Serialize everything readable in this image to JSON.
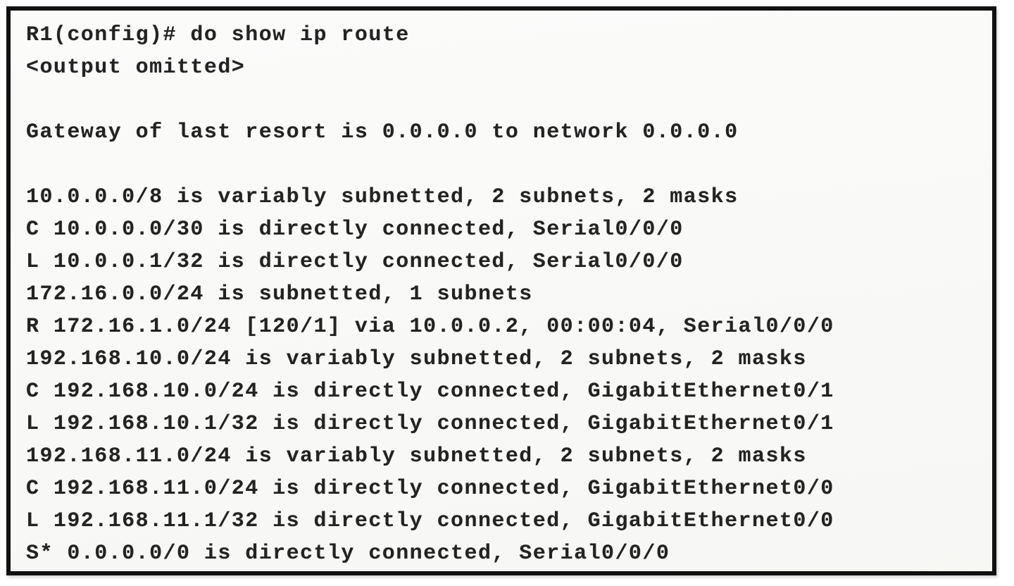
{
  "device": {
    "hostname": "R1",
    "mode": "config",
    "prompt": "R1(config)#"
  },
  "command": {
    "prompt_line": "R1(config)# do show ip route",
    "entered": "do show ip route",
    "omitted_notice": "<output omitted>"
  },
  "routing_table": {
    "gateway_of_last_resort": "Gateway of last resort is 0.0.0.0 to network 0.0.0.0",
    "lines": [
      "R1(config)# do show ip route",
      "<output omitted>",
      "",
      "Gateway of last resort is 0.0.0.0 to network 0.0.0.0",
      "",
      "10.0.0.0/8 is variably subnetted, 2 subnets, 2 masks",
      "C 10.0.0.0/30 is directly connected, Serial0/0/0",
      "L 10.0.0.1/32 is directly connected, Serial0/0/0",
      "172.16.0.0/24 is subnetted, 1 subnets",
      "R 172.16.1.0/24 [120/1] via 10.0.0.2, 00:00:04, Serial0/0/0",
      "192.168.10.0/24 is variably subnetted, 2 subnets, 2 masks",
      "C 192.168.10.0/24 is directly connected, GigabitEthernet0/1",
      "L 192.168.10.1/32 is directly connected, GigabitEthernet0/1",
      "192.168.11.0/24 is variably subnetted, 2 subnets, 2 masks",
      "C 192.168.11.0/24 is directly connected, GigabitEthernet0/0",
      "L 192.168.11.1/32 is directly connected, GigabitEthernet0/0",
      "S* 0.0.0.0/0 is directly connected, Serial0/0/0"
    ],
    "parent_networks": [
      {
        "network": "10.0.0.0/8",
        "subnetting": "is variably subnetted",
        "subnets": "2 subnets",
        "masks": "2 masks"
      },
      {
        "network": "172.16.0.0/24",
        "subnetting": "is subnetted",
        "subnets": "1 subnets",
        "masks": ""
      },
      {
        "network": "192.168.10.0/24",
        "subnetting": "is variably subnetted",
        "subnets": "2 subnets",
        "masks": "2 masks"
      },
      {
        "network": "192.168.11.0/24",
        "subnetting": "is variably subnetted",
        "subnets": "2 subnets",
        "masks": "2 masks"
      }
    ],
    "routes": [
      {
        "code": "C",
        "prefix": "10.0.0.0/30",
        "descriptor": "is directly connected",
        "metric": "",
        "next_hop": "",
        "uptime": "",
        "interface": "Serial0/0/0"
      },
      {
        "code": "L",
        "prefix": "10.0.0.1/32",
        "descriptor": "is directly connected",
        "metric": "",
        "next_hop": "",
        "uptime": "",
        "interface": "Serial0/0/0"
      },
      {
        "code": "R",
        "prefix": "172.16.1.0/24",
        "descriptor": "via",
        "metric": "[120/1]",
        "next_hop": "10.0.0.2",
        "uptime": "00:00:04",
        "interface": "Serial0/0/0"
      },
      {
        "code": "C",
        "prefix": "192.168.10.0/24",
        "descriptor": "is directly connected",
        "metric": "",
        "next_hop": "",
        "uptime": "",
        "interface": "GigabitEthernet0/1"
      },
      {
        "code": "L",
        "prefix": "192.168.10.1/32",
        "descriptor": "is directly connected",
        "metric": "",
        "next_hop": "",
        "uptime": "",
        "interface": "GigabitEthernet0/1"
      },
      {
        "code": "C",
        "prefix": "192.168.11.0/24",
        "descriptor": "is directly connected",
        "metric": "",
        "next_hop": "",
        "uptime": "",
        "interface": "GigabitEthernet0/0"
      },
      {
        "code": "L",
        "prefix": "192.168.11.1/32",
        "descriptor": "is directly connected",
        "metric": "",
        "next_hop": "",
        "uptime": "",
        "interface": "GigabitEthernet0/0"
      },
      {
        "code": "S*",
        "prefix": "0.0.0.0/0",
        "descriptor": "is directly connected",
        "metric": "",
        "next_hop": "",
        "uptime": "",
        "interface": "Serial0/0/0"
      }
    ]
  },
  "colors": {
    "frame": "#111111",
    "background": "#fbfbfa",
    "text": "#232323",
    "page": "#ffffff"
  }
}
